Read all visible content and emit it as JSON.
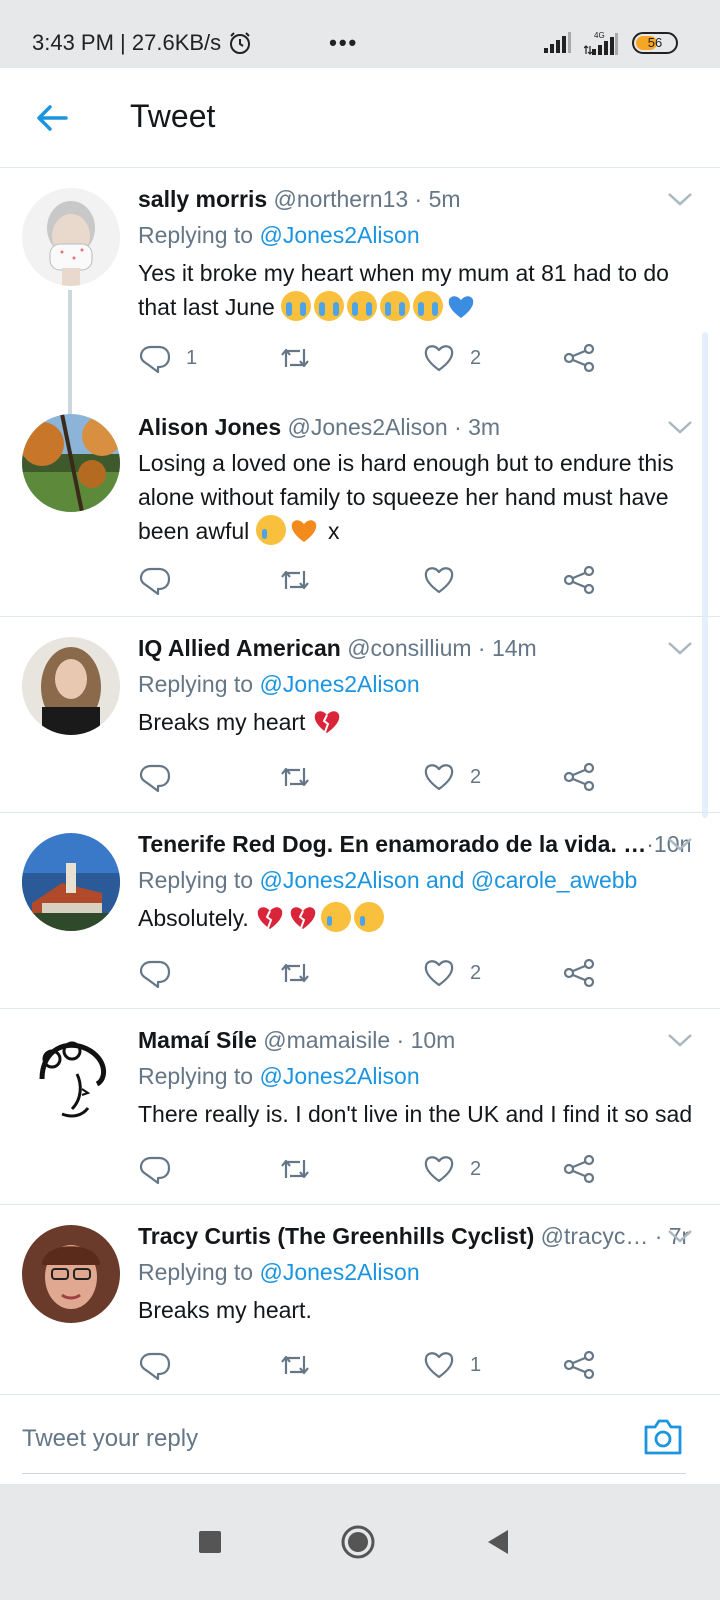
{
  "status_bar": {
    "time_speed": "3:43 PM | 27.6KB/s",
    "more": "•••",
    "network": "4G",
    "battery": "56",
    "battery_level": 0.56
  },
  "header": {
    "title": "Tweet"
  },
  "tweets": [
    {
      "name": "sally morris",
      "meta": "@northern13 · 5m",
      "replying_prefix": "Replying to ",
      "mentions": "@Jones2Alison",
      "text": "Yes it broke my heart when my mum at 81 had to do that last June",
      "replies": "1",
      "retweets": "",
      "likes": "2"
    },
    {
      "name": "Alison Jones",
      "meta": "@Jones2Alison · 3m",
      "text": "Losing a loved one is hard enough but to endure this alone without family to squeeze her hand must have been awful",
      "text_suffix": " x",
      "replies": "",
      "retweets": "",
      "likes": ""
    },
    {
      "name": "IQ Allied American",
      "meta": "@consillium · 14m",
      "replying_prefix": "Replying to ",
      "mentions": "@Jones2Alison",
      "text": "Breaks my heart",
      "replies": "",
      "retweets": "",
      "likes": "2"
    },
    {
      "name": "Tenerife Red Dog. En enamorado de la vida. …",
      "meta": "·10m",
      "replying_prefix": "Replying to ",
      "mentions": "@Jones2Alison and @carole_awebb",
      "text": "Absolutely.",
      "replies": "",
      "retweets": "",
      "likes": "2"
    },
    {
      "name": "Mamaí Síle",
      "meta": "@mamaisile · 10m",
      "replying_prefix": "Replying to ",
      "mentions": "@Jones2Alison",
      "text": "There really is. I don't live in the UK and I find it so sad",
      "replies": "",
      "retweets": "",
      "likes": "2"
    },
    {
      "name": "Tracy Curtis (The Greenhills Cyclist)",
      "meta": "@tracyc… · 7m",
      "replying_prefix": "Replying to ",
      "mentions": "@Jones2Alison",
      "text": "Breaks my heart.",
      "replies": "",
      "retweets": "",
      "likes": "1"
    }
  ],
  "reply_bar": {
    "placeholder": "Tweet your reply"
  },
  "colors": {
    "accent": "#1b95e0",
    "muted": "#657786",
    "divider": "#e1e8ed"
  },
  "icons": [
    "back-arrow-icon",
    "chevron-down-icon",
    "reply-icon",
    "retweet-icon",
    "heart-icon",
    "share-icon",
    "camera-icon",
    "square-icon",
    "circle-icon",
    "triangle-back-icon"
  ]
}
